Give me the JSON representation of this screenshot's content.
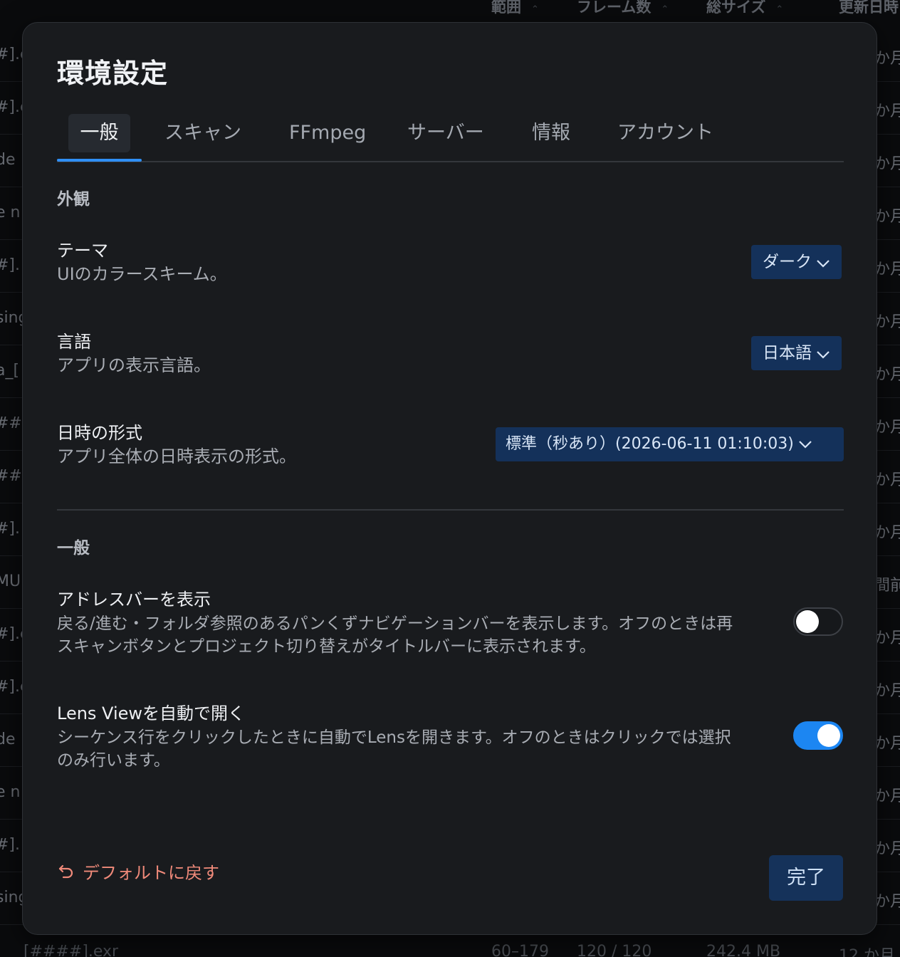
{
  "background": {
    "columns": [
      {
        "label": "範囲"
      },
      {
        "label": "フレーム数"
      },
      {
        "label": "総サイズ"
      },
      {
        "label": "更新日時"
      }
    ],
    "left_texts": [
      "#].e",
      "#].e",
      "de",
      "e n",
      "#].",
      "sing",
      "a_[",
      "###",
      "###",
      "#].",
      "MUI",
      "#].e",
      "#].e",
      "de",
      "e n",
      "#].",
      "sing"
    ],
    "right_texts": [
      "か月",
      "か月",
      "か月",
      "か月",
      "か月",
      "か月",
      "か月",
      "か月",
      "か月",
      "か月",
      "間前",
      "か月",
      "か月",
      "か月",
      "か月",
      "か月",
      "か月"
    ],
    "bottom_row": {
      "name": "_[####].exr",
      "range": "60–179",
      "frames": "120 / 120",
      "size": "242.4 MB",
      "updated": "12 か月"
    }
  },
  "dialog": {
    "title": "環境設定",
    "tabs": [
      {
        "label": "一般",
        "active": true
      },
      {
        "label": "スキャン"
      },
      {
        "label": "FFmpeg"
      },
      {
        "label": "サーバー"
      },
      {
        "label": "情報"
      },
      {
        "label": "アカウント"
      }
    ],
    "appearance": {
      "heading": "外観",
      "theme": {
        "label": "テーマ",
        "desc": "UIのカラースキーム。",
        "value": "ダーク"
      },
      "language": {
        "label": "言語",
        "desc": "アプリの表示言語。",
        "value": "日本語"
      },
      "datetime": {
        "label": "日時の形式",
        "desc": "アプリ全体の日時表示の形式。",
        "value": "標準（秒あり）(2026-06-11 01:10:03)"
      }
    },
    "general": {
      "heading": "一般",
      "address_bar": {
        "label": "アドレスバーを表示",
        "desc_line1": "戻る/進む・フォルダ参照のあるパンくずナビゲーションバーを表示します。オフのときは再",
        "desc_line2": "スキャンボタンとプロジェクト切り替えがタイトルバーに表示されます。",
        "enabled": false
      },
      "lens_view": {
        "label": "Lens Viewを自動で開く",
        "desc_line1": "シーケンス行をクリックしたときに自動でLensを開きます。オフのときはクリックでは選択",
        "desc_line2": "のみ行います。",
        "enabled": true
      }
    },
    "footer": {
      "reset_label": "デフォルトに戻す",
      "done_label": "完了"
    },
    "colors": {
      "accent": "#2f8ff5",
      "toggle_on": "#1c86f2",
      "select_bg": "#14315a",
      "reset_text": "#f08a7a",
      "dialog_bg": "#191b1e"
    }
  }
}
